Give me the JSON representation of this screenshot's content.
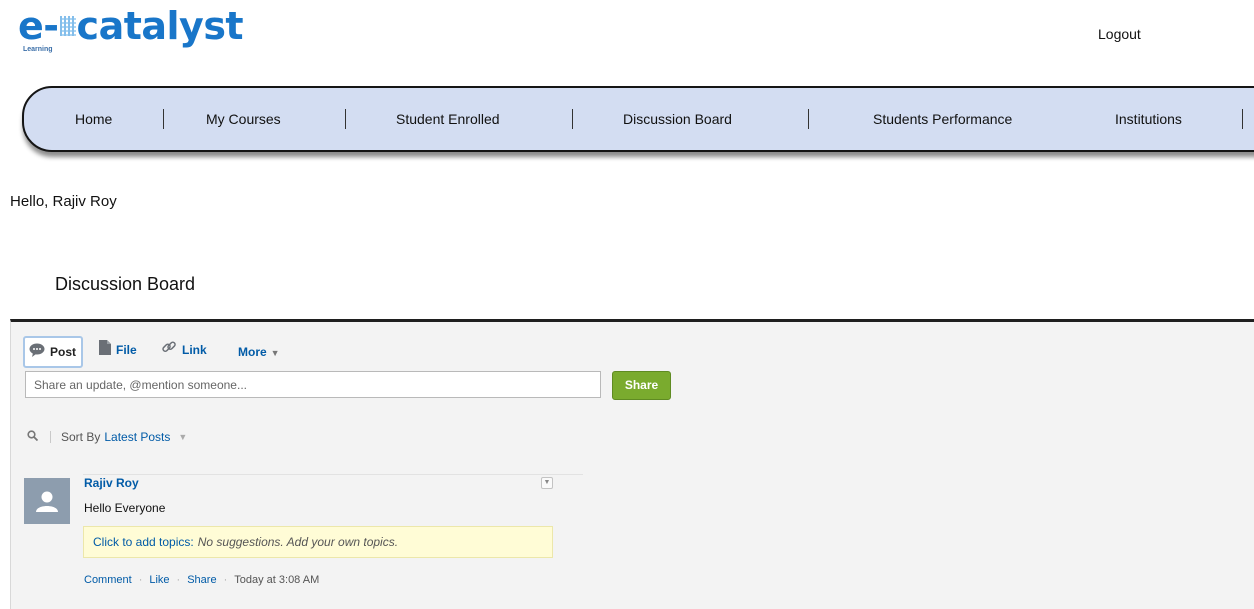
{
  "header": {
    "logo_text_prefix": "e-",
    "logo_text_main": "catalyst",
    "logo_subtext": "Learning",
    "logout_label": "Logout"
  },
  "nav": {
    "items": [
      {
        "label": "Home"
      },
      {
        "label": "My Courses"
      },
      {
        "label": "Student Enrolled"
      },
      {
        "label": "Discussion Board"
      },
      {
        "label": "Students Performance"
      },
      {
        "label": "Institutions"
      }
    ]
  },
  "greeting": "Hello, Rajiv Roy",
  "page_title": "Discussion Board",
  "publisher": {
    "tabs": [
      {
        "label": "Post",
        "icon": "speech-bubble-icon",
        "active": true
      },
      {
        "label": "File",
        "icon": "file-icon",
        "active": false
      },
      {
        "label": "Link",
        "icon": "link-icon",
        "active": false
      },
      {
        "label": "More",
        "icon": "chevron-down-icon",
        "active": false
      }
    ],
    "input_placeholder": "Share an update, @mention someone...",
    "input_value": "",
    "share_label": "Share"
  },
  "sort": {
    "label": "Sort By",
    "value": "Latest Posts"
  },
  "posts": [
    {
      "author": "Rajiv Roy",
      "body": "Hello Everyone",
      "topics_link": "Click to add topics:",
      "topics_hint": "No suggestions. Add your own topics.",
      "actions": [
        "Comment",
        "Like",
        "Share"
      ],
      "timestamp": "Today at 3:08 AM"
    }
  ],
  "colors": {
    "logo_blue": "#1976c9",
    "nav_background": "#d3ddf2",
    "link_blue": "#015ba7",
    "share_green": "#7aab2e",
    "topics_background": "#fffcd6"
  }
}
